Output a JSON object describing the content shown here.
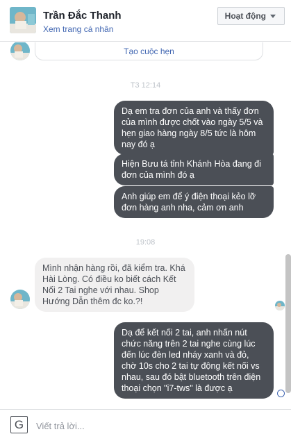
{
  "header": {
    "name": "Trần Đắc Thanh",
    "profile_link": "Xem trang cá nhân",
    "action_label": "Hoạt động"
  },
  "card": {
    "link": "Tạo cuộc hẹn"
  },
  "messages": [
    {
      "type": "timestamp",
      "text": "T3 12:14"
    },
    {
      "type": "outgoing",
      "text": "Dạ em tra đơn của anh và thấy đơn của mình được chốt vào ngày 5/5 và hẹn giao hàng ngày 8/5 tức là hôm nay đó ạ"
    },
    {
      "type": "outgoing",
      "text": "Hiện Bưu tá tỉnh Khánh Hòa đang đi đơn của mình đó ạ"
    },
    {
      "type": "outgoing",
      "text": "Anh giúp em để ý điện thoại kẻo lỡ đơn hàng anh nha, cảm ơn anh"
    },
    {
      "type": "timestamp",
      "text": "19:08"
    },
    {
      "type": "incoming",
      "text": "Mình nhận hàng rồi, đã kiểm tra. Khá Hài Lòng. Có điều ko biết cách Kết Nối 2 Tai nghe với nhau. Shop Hướng Dẫn thêm đc ko.?!"
    },
    {
      "type": "outgoing",
      "text": "Dạ để kết nối 2 tai, anh nhấn nút chức năng trên 2 tai nghe cùng lúc đến lúc đèn led nháy xanh và đỏ, chờ 10s cho 2 tai tự động kết nối vs nhau, sau đó bật bluetooth trên điện thoại chọn \"i7-tws\" là được ạ"
    }
  ],
  "composer": {
    "placeholder": "Viết trả lời...",
    "icon_glyph": "G"
  },
  "colors": {
    "outgoing_bubble": "#4b4f56",
    "incoming_bubble": "#f1f0f0",
    "link": "#4267b2"
  }
}
